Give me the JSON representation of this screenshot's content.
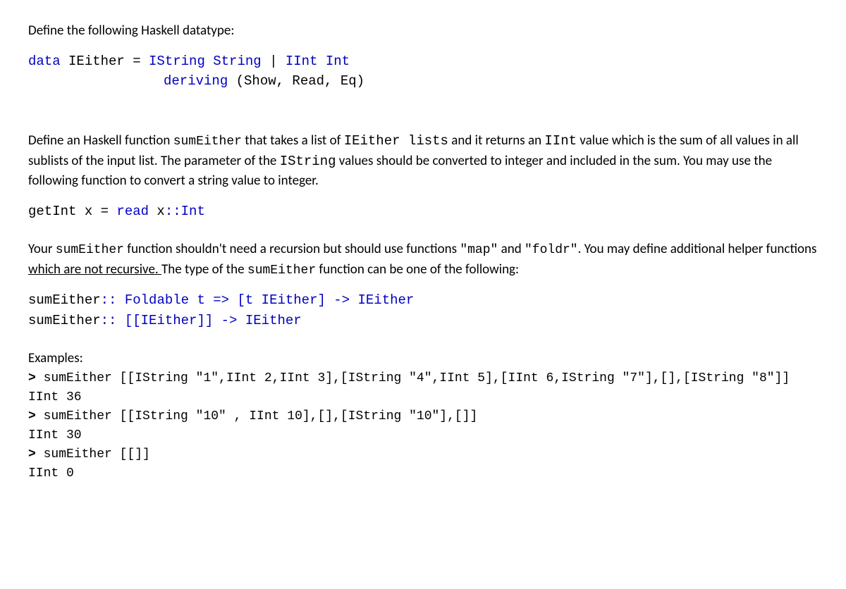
{
  "intro": "Define the following Haskell datatype:",
  "datadef": {
    "l1_a": "data",
    "l1_b": " IEither  = ",
    "l1_c": "IString String ",
    "l1_d": "|",
    "l1_e": " IInt Int",
    "l2_a": "deriving",
    "l2_b": " (Show, Read, Eq)"
  },
  "p1": {
    "a": "Define an Haskell function ",
    "b": "sumEither",
    "c": " that takes a list of ",
    "d": "IEither lists",
    "e": " and it returns an ",
    "f": "IInt",
    "g": " value which is the sum of all values  in all sublists of the input list. The parameter of the ",
    "h": "IString",
    "i": "  values should be converted to integer and included in the sum. You may use the following function to convert a string value to integer."
  },
  "getint": {
    "a": "getInt x = ",
    "b": "read",
    "c": " x",
    "d": "::Int"
  },
  "p2": {
    "a": "Your ",
    "b": "sumEither",
    "c": "  function shouldn't need a recursion but should use functions  ",
    "d": "\"map\"",
    "e": "  and ",
    "f": "\"foldr\"",
    "g": ".  You may define additional helper functions ",
    "h": "which are not recursive. ",
    "i": " The type of the ",
    "j": "sumEither",
    "k": " function can be one of the following:"
  },
  "sig1": {
    "a": "sumEither",
    "b": ":: Foldable t => [t IEither] -> IEither"
  },
  "sig2": {
    "a": "sumEither",
    "b": ":: [[IEither]] -> IEither"
  },
  "examples_hdr": "Examples:",
  "ex1": {
    "p": "> ",
    "a": "sumEither [[IString \"1\",IInt 2,IInt 3],[IString \"4\",IInt 5],[IInt 6,IString \"7\"],[],[IString \"8\"]]",
    "r": "IInt 36"
  },
  "ex2": {
    "p": "> ",
    "a": "sumEither [[IString \"10\" , IInt 10],[],[IString \"10\"],[]]",
    "r": "IInt 30"
  },
  "ex3": {
    "p": "> ",
    "a": "sumEither [[]]",
    "r": "IInt 0"
  }
}
